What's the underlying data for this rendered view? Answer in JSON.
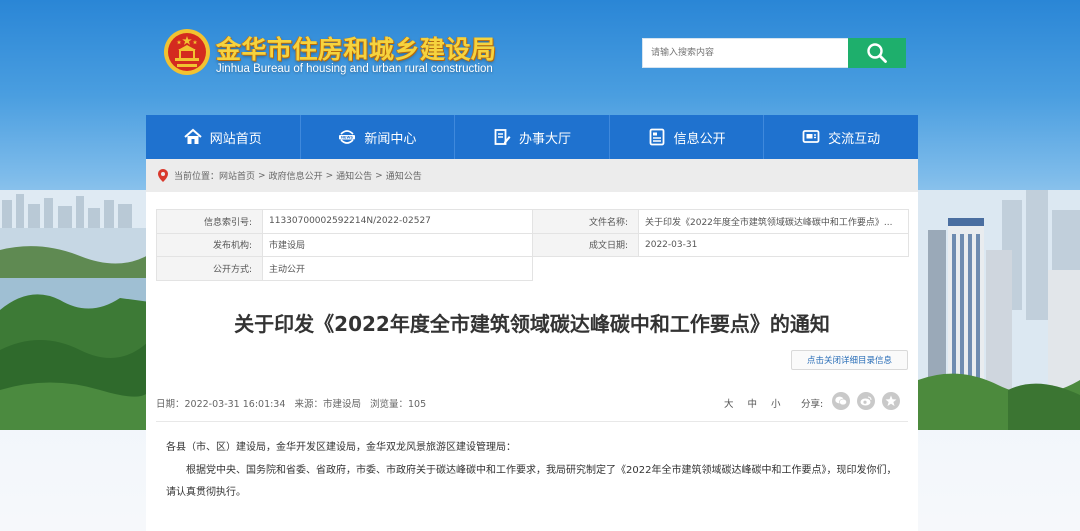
{
  "header": {
    "title": "金华市住房和城乡建设局",
    "subtitle": "Jinhua Bureau of housing and urban rural construction",
    "search_placeholder": "请输入搜索内容"
  },
  "nav": {
    "items": [
      {
        "label": "网站首页",
        "icon": "home-icon"
      },
      {
        "label": "新闻中心",
        "icon": "news-icon"
      },
      {
        "label": "办事大厅",
        "icon": "document-edit-icon"
      },
      {
        "label": "信息公开",
        "icon": "info-list-icon"
      },
      {
        "label": "交流互动",
        "icon": "chat-icon"
      }
    ]
  },
  "breadcrumb": {
    "prefix": "当前位置：",
    "items": [
      "网站首页",
      "政府信息公开",
      "通知公告",
      "通知公告"
    ],
    "separator": ">"
  },
  "info": {
    "index_label": "信息索引号:",
    "index_value": "11330700002592214N/2022-02527",
    "filename_label": "文件名称:",
    "filename_value": "关于印发《2022年度全市建筑领域碳达峰碳中和工作要点》...",
    "publisher_label": "发布机构:",
    "publisher_value": "市建设局",
    "date_label": "成文日期:",
    "date_value": "2022-03-31",
    "mode_label": "公开方式:",
    "mode_value": "主动公开"
  },
  "article": {
    "title": "关于印发《2022年度全市建筑领域碳达峰碳中和工作要点》的通知",
    "catalog_button": "点击关闭详细目录信息",
    "meta_date": "日期：2022-03-31 16:01:34",
    "meta_source": "来源：市建设局",
    "meta_views": "浏览量：105",
    "font_large": "大",
    "font_medium": "中",
    "font_small": "小",
    "share_label": "分享:",
    "salutation": "各县（市、区）建设局，金华开发区建设局，金华双龙风景旅游区建设管理局：",
    "paragraph": "根据党中央、国务院和省委、省政府，市委、市政府关于碳达峰碳中和工作要求，我局研究制定了《2022年全市建筑领域碳达峰碳中和工作要点》，现印发你们，请认真贯彻执行。"
  },
  "colors": {
    "nav_bg": "#1f72cf",
    "search_button": "#1eaf6c",
    "title_gold": "#f6d33e"
  }
}
